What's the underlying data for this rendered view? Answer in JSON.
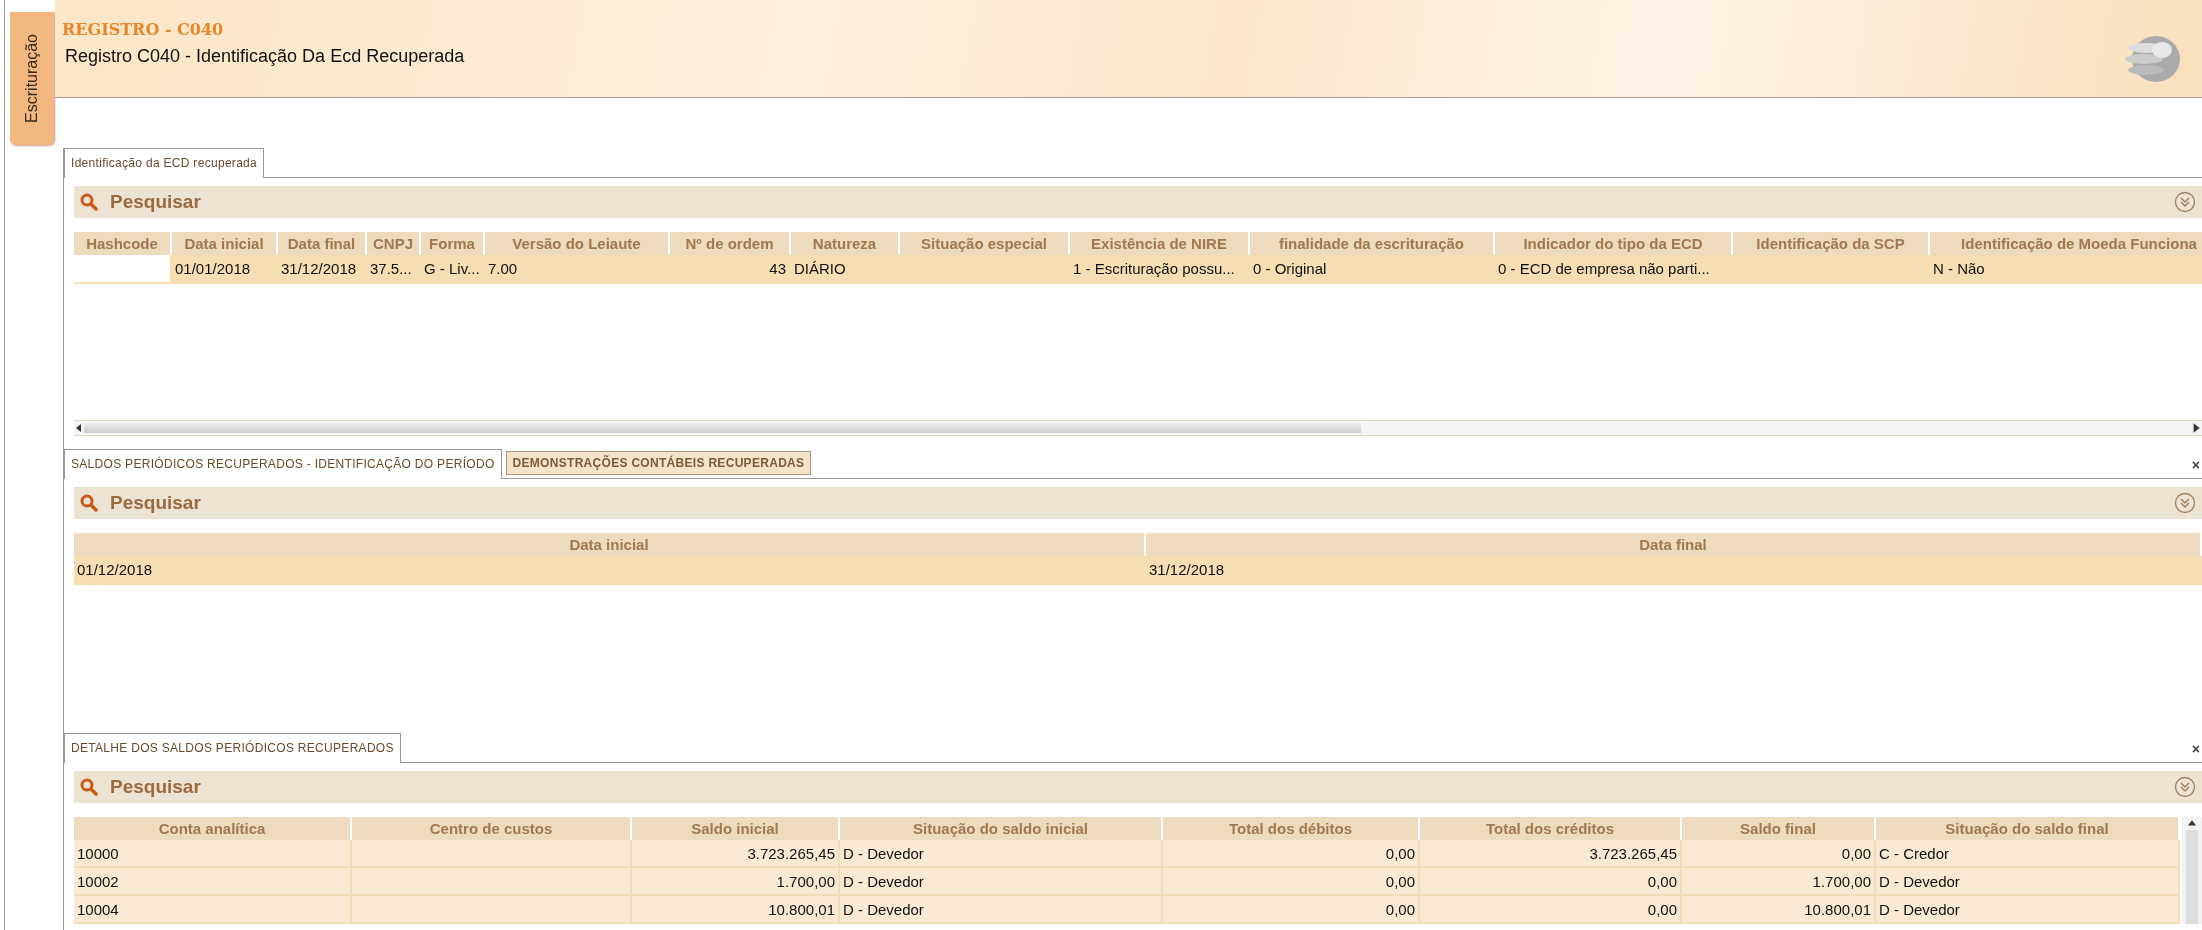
{
  "side_tab": {
    "label": "Escrituração"
  },
  "header": {
    "title": "REGISTRO - C040",
    "subtitle": "Registro C040 - Identificação Da Ecd Recuperada"
  },
  "sections": [
    {
      "tabs": [
        {
          "label": "Identificação da ECD recuperada",
          "selected": true
        }
      ],
      "search": {
        "label": "Pesquisar"
      },
      "table": {
        "columns": [
          {
            "label": "Hashcode",
            "kind": "text"
          },
          {
            "label": "Data inicial",
            "kind": "text"
          },
          {
            "label": "Data final",
            "kind": "text"
          },
          {
            "label": "CNPJ",
            "kind": "text"
          },
          {
            "label": "Forma",
            "kind": "text"
          },
          {
            "label": "Versão do Leiaute",
            "kind": "text"
          },
          {
            "label": "Nº de ordem",
            "kind": "number"
          },
          {
            "label": "Natureza",
            "kind": "text"
          },
          {
            "label": "Situação especial",
            "kind": "text"
          },
          {
            "label": "Existência de NIRE",
            "kind": "text"
          },
          {
            "label": "finalidade da escrituração",
            "kind": "text"
          },
          {
            "label": "Indicador do tipo da ECD",
            "kind": "text"
          },
          {
            "label": "Identificação da SCP",
            "kind": "text"
          },
          {
            "label": "Identificação de Moeda Funciona",
            "kind": "text"
          }
        ],
        "rows": [
          {
            "selected": true,
            "cells": [
              null,
              "01/01/2018",
              "31/12/2018",
              "37.5...",
              "G - Liv...",
              "7.00",
              "43",
              "DIÁRIO",
              null,
              "1 - Escrituração possu...",
              "0 - Original",
              "0 - ECD de empresa não parti...",
              null,
              "N - Não"
            ]
          }
        ]
      }
    },
    {
      "tabs": [
        {
          "label": "SALDOS PERIÓDICOS RECUPERADOS - IDENTIFICAÇÃO DO PERÍODO",
          "selected": true
        },
        {
          "label": "DEMONSTRAÇÕES CONTÁBEIS RECUPERADAS",
          "selected": false
        }
      ],
      "close": "×",
      "search": {
        "label": "Pesquisar"
      },
      "table": {
        "columns": [
          {
            "label": "Data inicial",
            "kind": "text"
          },
          {
            "label": "Data final",
            "kind": "text"
          }
        ],
        "rows": [
          {
            "selected": true,
            "cells": [
              "01/12/2018",
              "31/12/2018"
            ]
          }
        ]
      }
    },
    {
      "tabs": [
        {
          "label": "DETALHE DOS SALDOS PERIÓDICOS RECUPERADOS",
          "selected": true
        }
      ],
      "close": "×",
      "search": {
        "label": "Pesquisar"
      },
      "table": {
        "columns": [
          {
            "label": "Conta analítica",
            "kind": "text"
          },
          {
            "label": "Centro de custos",
            "kind": "text"
          },
          {
            "label": "Saldo inicial",
            "kind": "number"
          },
          {
            "label": "Situação do saldo inicial",
            "kind": "text"
          },
          {
            "label": "Total dos débitos",
            "kind": "number"
          },
          {
            "label": "Total dos créditos",
            "kind": "number"
          },
          {
            "label": "Saldo final",
            "kind": "number"
          },
          {
            "label": "Situação do saldo final",
            "kind": "text"
          }
        ],
        "rows": [
          {
            "selected": false,
            "cells": [
              "10000",
              null,
              "3.723.265,45",
              "D - Devedor",
              "0,00",
              "3.723.265,45",
              "0,00",
              "C - Credor"
            ]
          },
          {
            "selected": false,
            "cells": [
              "10002",
              null,
              "1.700,00",
              "D - Devedor",
              "0,00",
              "0,00",
              "1.700,00",
              "D - Devedor"
            ]
          },
          {
            "selected": false,
            "cells": [
              "10004",
              null,
              "10.800,01",
              "D - Devedor",
              "0,00",
              "0,00",
              "10.800,01",
              "D - Devedor"
            ]
          }
        ]
      }
    }
  ]
}
